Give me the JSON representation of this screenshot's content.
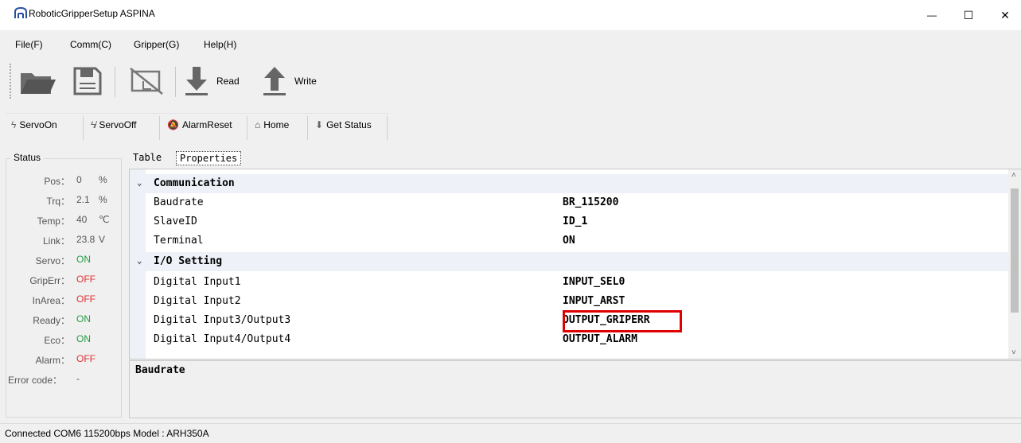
{
  "window": {
    "title": "RoboticGripperSetup ASPINA",
    "minimize": "—",
    "maximize": "☐",
    "close": "✕"
  },
  "menu": [
    "File(F)",
    "Comm(C)",
    "Gripper(G)",
    "Help(H)"
  ],
  "toolbar": {
    "icons": [
      "folder-open-icon",
      "save-icon",
      "disconnect-icon",
      "download-icon",
      "upload-icon"
    ],
    "read_label": "Read",
    "write_label": "Write"
  },
  "toolbar2": {
    "servo_on": "ServoOn",
    "servo_off": "ServoOff",
    "alarm_reset": "AlarmReset",
    "home": "Home",
    "get_status": "Get Status"
  },
  "status": {
    "title": "Status",
    "rows": [
      {
        "label": "Pos：",
        "value": "0",
        "unit": "%"
      },
      {
        "label": "Trq：",
        "value": "2.1",
        "unit": "%"
      },
      {
        "label": "Temp：",
        "value": "40",
        "unit": "℃"
      },
      {
        "label": "Link：",
        "value": "23.8",
        "unit": "V"
      },
      {
        "label": "Servo：",
        "value": "ON",
        "unit": ""
      },
      {
        "label": "GripErr：",
        "value": "OFF",
        "unit": ""
      },
      {
        "label": "InArea：",
        "value": "OFF",
        "unit": ""
      },
      {
        "label": "Ready：",
        "value": "ON",
        "unit": ""
      },
      {
        "label": "Eco：",
        "value": "ON",
        "unit": ""
      },
      {
        "label": "Alarm：",
        "value": "OFF",
        "unit": ""
      },
      {
        "label": "Error code：",
        "value": "-",
        "unit": ""
      }
    ]
  },
  "tabs": [
    "Table",
    "Properties"
  ],
  "grid": {
    "categories": [
      "Communication",
      "I/O Setting"
    ],
    "rows": [
      {
        "name": "Baudrate",
        "value": "BR_115200"
      },
      {
        "name": "SlaveID",
        "value": "ID_1"
      },
      {
        "name": "Terminal",
        "value": "ON"
      },
      {
        "name": "Digital Input1",
        "value": "INPUT_SEL0"
      },
      {
        "name": "Digital Input2",
        "value": "INPUT_ARST"
      },
      {
        "name": "Digital Input3/Output3",
        "value": "OUTPUT_GRIPERR"
      },
      {
        "name": "Digital Input4/Output4",
        "value": "OUTPUT_ALARM"
      }
    ]
  },
  "description": "Baudrate",
  "statusbar": "Connected COM6 115200bps  Model : ARH350A",
  "colors": {
    "on": "#1e9e3e",
    "off": "#e03030",
    "highlight": "#e00000"
  }
}
